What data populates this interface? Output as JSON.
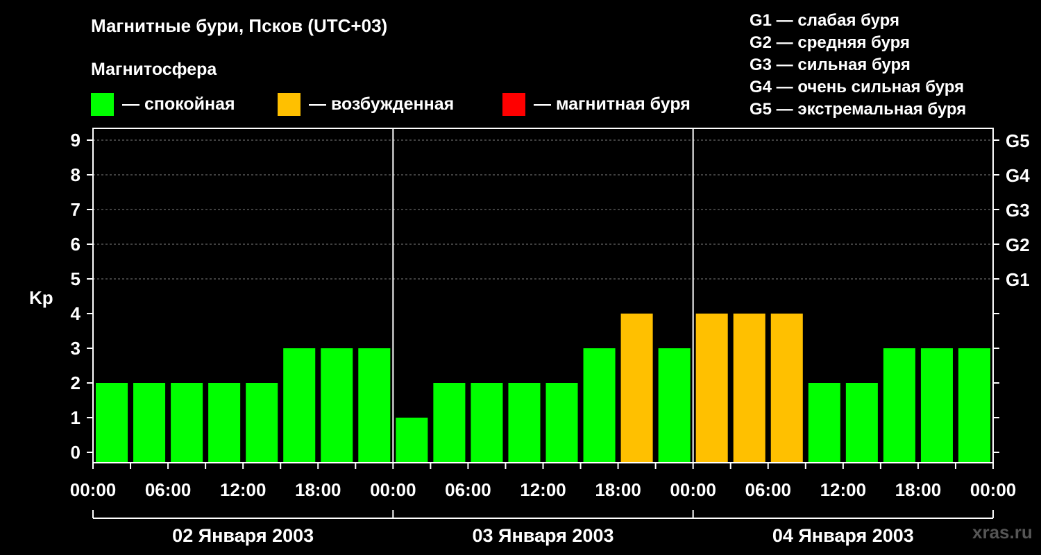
{
  "header": {
    "title": "Магнитные бури, Псков (UTC+03)",
    "subtitle": "Магнитосфера"
  },
  "legend": [
    {
      "label": "— спокойная",
      "color": "#00ff00"
    },
    {
      "label": "— возбужденная",
      "color": "#ffc000"
    },
    {
      "label": "— магнитная буря",
      "color": "#ff0000"
    }
  ],
  "storm_levels": [
    "G1 — слабая буря",
    "G2 — средняя буря",
    "G3 — сильная буря",
    "G4 — очень сильная буря",
    "G5 — экстремальная буря"
  ],
  "watermark": "xras.ru",
  "chart_data": {
    "type": "bar",
    "title": "Магнитные бури, Псков (UTC+03)",
    "ylabel": "Kp",
    "ylim": [
      0,
      9
    ],
    "yticks": [
      "0",
      "1",
      "2",
      "3",
      "4",
      "5",
      "6",
      "7",
      "8",
      "9"
    ],
    "right_ticks": [
      {
        "value": 5,
        "label": "G1"
      },
      {
        "value": 6,
        "label": "G2"
      },
      {
        "value": 7,
        "label": "G3"
      },
      {
        "value": 8,
        "label": "G4"
      },
      {
        "value": 9,
        "label": "G5"
      }
    ],
    "xtick_labels": [
      "00:00",
      "06:00",
      "12:00",
      "18:00",
      "00:00",
      "06:00",
      "12:00",
      "18:00",
      "00:00",
      "06:00",
      "12:00",
      "18:00",
      "00:00"
    ],
    "days": [
      "02 Января 2003",
      "03 Января 2003",
      "04 Января 2003"
    ],
    "interval_hours": 3,
    "values": [
      2,
      2,
      2,
      2,
      2,
      3,
      3,
      3,
      1,
      2,
      2,
      2,
      2,
      3,
      4,
      3,
      4,
      4,
      4,
      2,
      2,
      3,
      3,
      3
    ],
    "colors": {
      "quiet": "#00ff00",
      "active": "#ffc000",
      "storm": "#ff0000"
    },
    "grid": "dashed horizontal at 5-9",
    "legend_position": "top"
  }
}
